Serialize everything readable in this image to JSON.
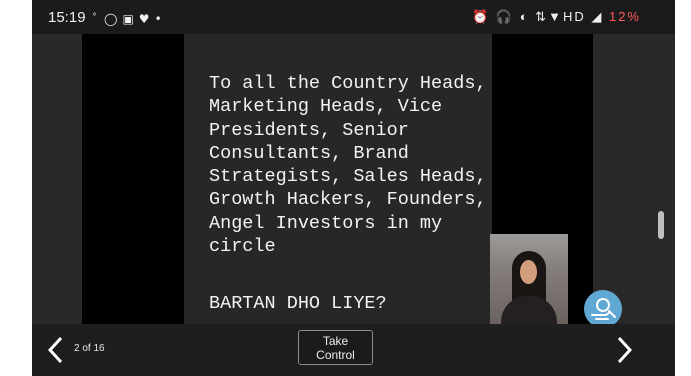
{
  "status_bar": {
    "time": "15:19",
    "left_icons": [
      "signal-text-icon",
      "whatsapp-icon",
      "teams-icon",
      "heart-icon",
      "dot-icon"
    ],
    "right_icons_text": "⏰ 🎧 ◐ ⇅▼HD ◢",
    "battery": "12%"
  },
  "slide": {
    "body": "To all the Country Heads,\nMarketing Heads, Vice\nPresidents, Senior\nConsultants, Brand\nStrategists, Sales Heads,\nGrowth Hackers, Founders,\nAngel Investors in my\ncircle",
    "footer": "BARTAN DHO LIYE?"
  },
  "controls": {
    "page_counter": "2 of 16",
    "take_control": "Take Control"
  },
  "colors": {
    "background": "#202020",
    "accent": "#60a8d4"
  }
}
